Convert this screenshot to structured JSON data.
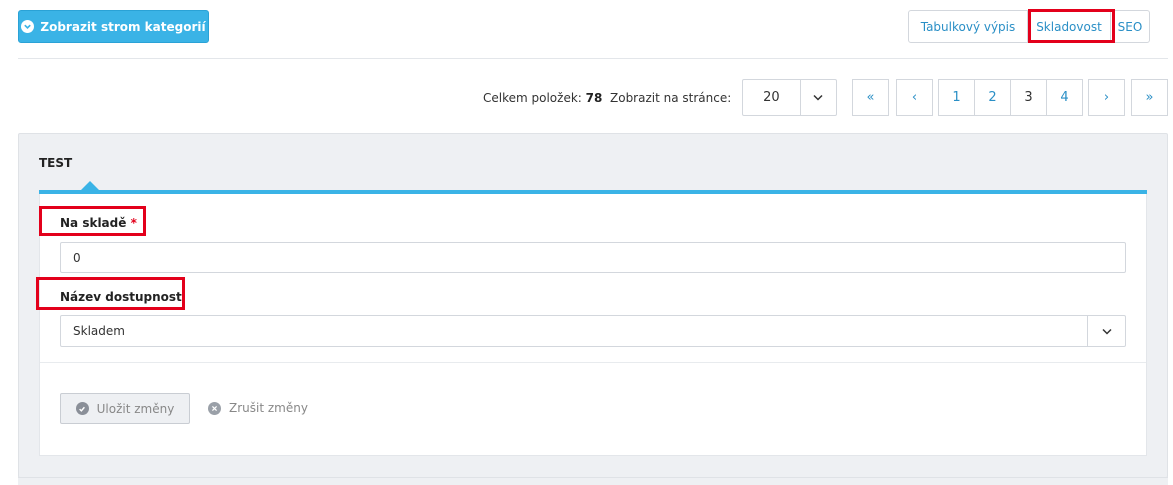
{
  "toolbar": {
    "tree_button_label": "Zobrazit strom kategorií",
    "view_tabs": [
      "Tabulkový výpis",
      "Skladovost",
      "SEO"
    ],
    "active_view": "Skladovost"
  },
  "pager": {
    "total_label": "Celkem položek:",
    "total_value": "78",
    "per_page_label": "Zobrazit na stránce:",
    "per_page_value": "20",
    "first": "«",
    "prev": "‹",
    "pages": [
      "1",
      "2",
      "3",
      "4"
    ],
    "current_page": "3",
    "next": "›",
    "last": "»"
  },
  "panel": {
    "title": "TEST",
    "stock_label": "Na skladě",
    "required_mark": "*",
    "stock_value": "0",
    "availability_label": "Název dostupnosti",
    "availability_value": "Skladem",
    "save_label": "Uložit změny",
    "cancel_label": "Zrušit změny"
  },
  "colors": {
    "accent": "#3ab3e6",
    "link": "#2a8fc6",
    "highlight": "#e3001b"
  }
}
